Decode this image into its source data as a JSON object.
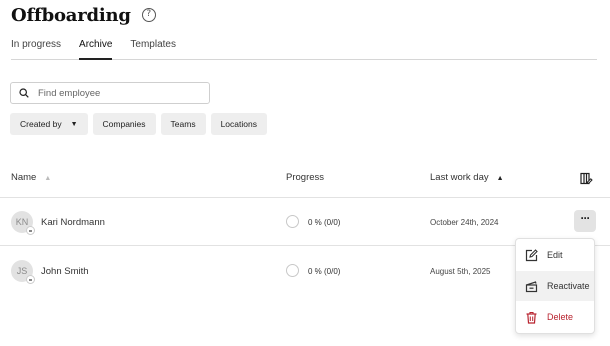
{
  "page": {
    "title": "Offboarding",
    "help_icon": "help-circle-icon"
  },
  "tabs": [
    {
      "label": "In progress",
      "active": false
    },
    {
      "label": "Archive",
      "active": true
    },
    {
      "label": "Templates",
      "active": false
    }
  ],
  "search": {
    "placeholder": "Find employee",
    "value": "",
    "icon": "search-icon"
  },
  "filters": {
    "created_by": "Created by",
    "companies": "Companies",
    "teams": "Teams",
    "locations": "Locations"
  },
  "table": {
    "columns": {
      "name": "Name",
      "progress": "Progress",
      "last_work_day": "Last work day"
    },
    "sort": {
      "column": "last_work_day",
      "direction": "ascending"
    },
    "rows": [
      {
        "initials": "KN",
        "name": "Kari Nordmann",
        "progress": "0 % (0/0)",
        "last_work_day": "October 24th, 2024"
      },
      {
        "initials": "JS",
        "name": "John Smith",
        "progress": "0 % (0/0)",
        "last_work_day": "August 5th, 2025"
      }
    ]
  },
  "context_menu": {
    "items": [
      {
        "label": "Edit",
        "icon": "edit-icon"
      },
      {
        "label": "Reactivate",
        "icon": "reactivate-icon",
        "highlighted": true
      },
      {
        "label": "Delete",
        "icon": "trash-icon",
        "color": "#b8232f"
      }
    ]
  }
}
